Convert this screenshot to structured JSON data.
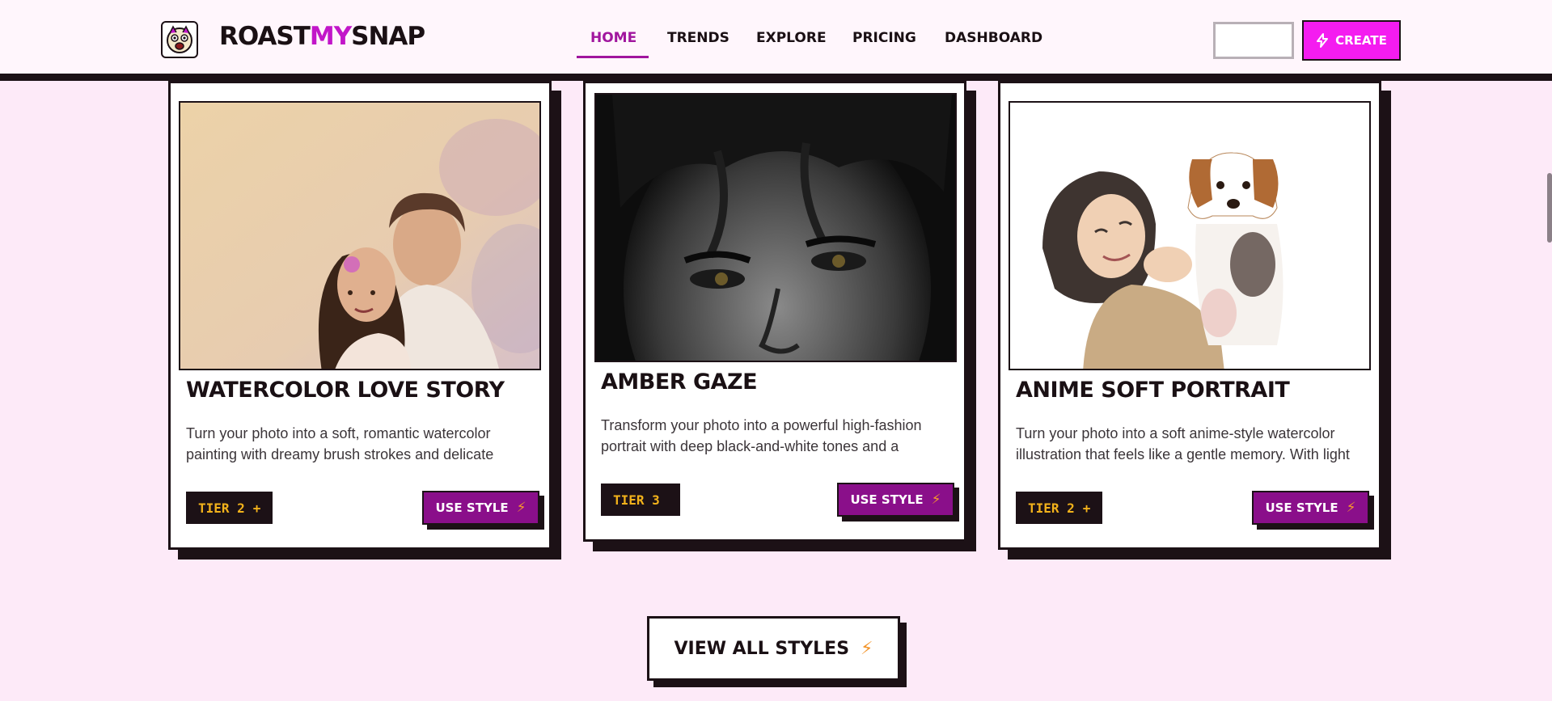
{
  "brand": {
    "name_prefix": "ROAST",
    "name_highlight": "MY",
    "name_suffix": "SNAP"
  },
  "nav": {
    "items": [
      {
        "label": "HOME",
        "active": true
      },
      {
        "label": "TRENDS"
      },
      {
        "label": "EXPLORE"
      },
      {
        "label": "PRICING"
      },
      {
        "label": "DASHBOARD"
      }
    ]
  },
  "header_actions": {
    "ghost_label": "",
    "create_label": "CREATE"
  },
  "cards": [
    {
      "title": "WATERCOLOR LOVE STORY",
      "description": "Turn your photo into a soft, romantic watercolor painting with dreamy brush strokes and delicate",
      "tier": "TIER 2",
      "tier_icon": "+",
      "button": "USE STYLE"
    },
    {
      "title": "AMBER GAZE",
      "description": "Transform your photo into a powerful high-fashion portrait with deep black-and-white tones and a",
      "tier": "TIER 3",
      "tier_icon": "",
      "button": "USE STYLE"
    },
    {
      "title": "ANIME SOFT PORTRAIT",
      "description": "Turn your photo into a soft anime-style watercolor illustration that feels like a gentle memory. With light",
      "tier": "TIER 2",
      "tier_icon": "+",
      "button": "USE STYLE"
    }
  ],
  "view_all": {
    "label": "VIEW ALL STYLES"
  },
  "colors": {
    "accent": "#f41cf0",
    "primary_button": "#8a0f8a",
    "tier_text": "#f2b21b",
    "ink": "#1c1116",
    "background": "#fdeaf8"
  }
}
